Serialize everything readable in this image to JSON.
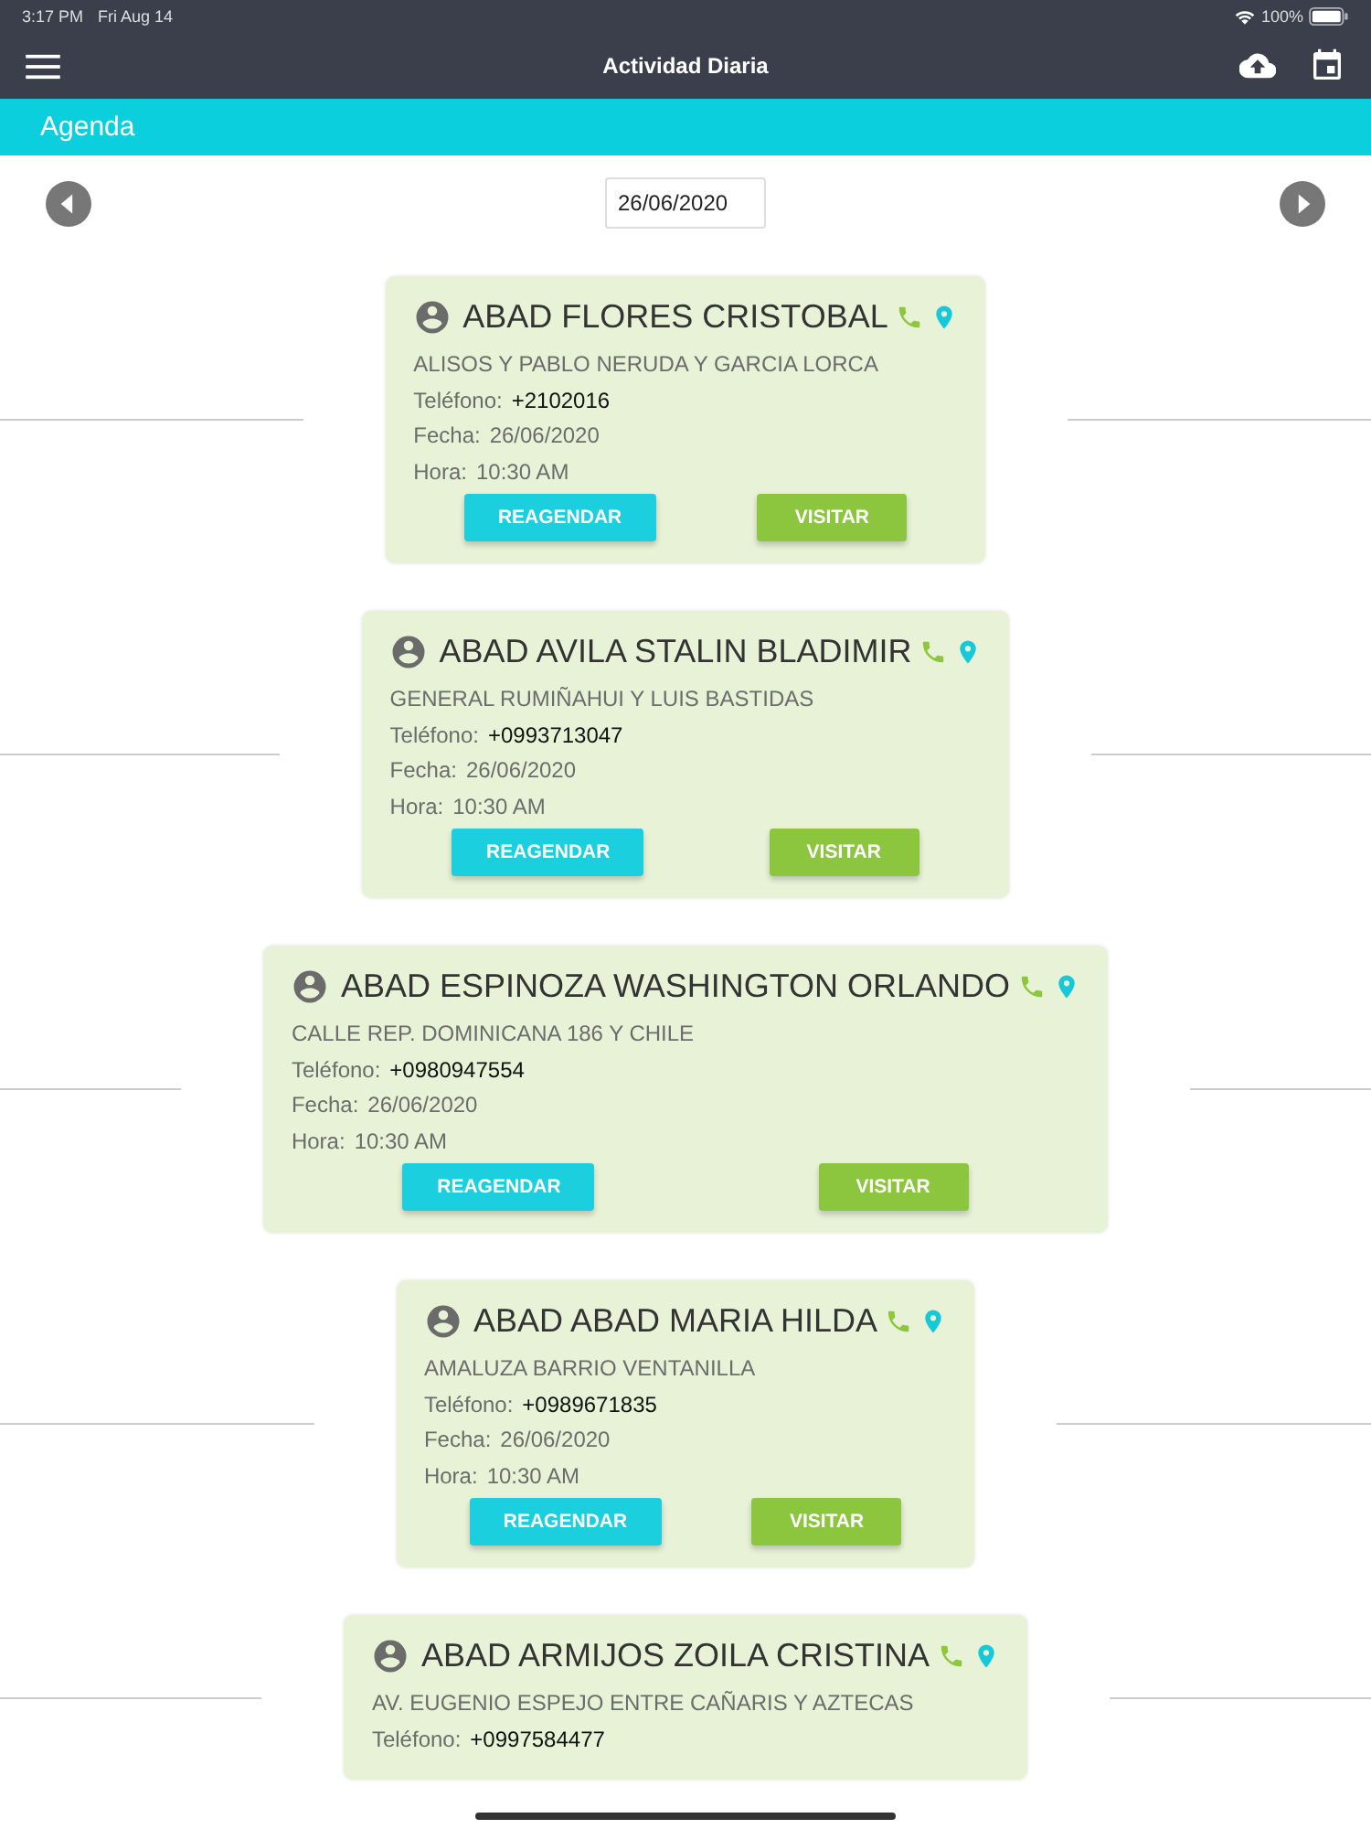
{
  "status_bar": {
    "time": "3:17 PM",
    "date": "Fri Aug 14",
    "battery": "100%"
  },
  "header": {
    "title": "Actividad Diaria"
  },
  "section": {
    "title": "Agenda"
  },
  "date_nav": {
    "date": "26/06/2020"
  },
  "appointments": [
    {
      "name": "ABAD FLORES CRISTOBAL",
      "address": "ALISOS Y PABLO NERUDA Y GARCIA LORCA",
      "phone_label": "Teléfono:",
      "phone": "+2102016",
      "date_label": "Fecha:",
      "date": "26/06/2020",
      "time_label": "Hora:",
      "time": "10:30 AM",
      "reschedule": "REAGENDAR",
      "visit": "VISITAR"
    },
    {
      "name": "ABAD AVILA STALIN BLADIMIR",
      "address": "GENERAL RUMIÑAHUI Y LUIS BASTIDAS",
      "phone_label": "Teléfono:",
      "phone": "+0993713047",
      "date_label": "Fecha:",
      "date": "26/06/2020",
      "time_label": "Hora:",
      "time": "10:30 AM",
      "reschedule": "REAGENDAR",
      "visit": "VISITAR"
    },
    {
      "name": "ABAD ESPINOZA WASHINGTON ORLANDO",
      "address": "CALLE REP. DOMINICANA 186 Y CHILE",
      "phone_label": "Teléfono:",
      "phone": "+0980947554",
      "date_label": "Fecha:",
      "date": "26/06/2020",
      "time_label": "Hora:",
      "time": "10:30 AM",
      "reschedule": "REAGENDAR",
      "visit": "VISITAR"
    },
    {
      "name": "ABAD ABAD MARIA HILDA",
      "address": "AMALUZA BARRIO VENTANILLA",
      "phone_label": "Teléfono:",
      "phone": "+0989671835",
      "date_label": "Fecha:",
      "date": "26/06/2020",
      "time_label": "Hora:",
      "time": "10:30 AM",
      "reschedule": "REAGENDAR",
      "visit": "VISITAR"
    },
    {
      "name": "ABAD ARMIJOS ZOILA CRISTINA",
      "address": "AV. EUGENIO ESPEJO ENTRE CAÑARIS Y AZTECAS",
      "phone_label": "Teléfono:",
      "phone": "+0997584477"
    }
  ]
}
